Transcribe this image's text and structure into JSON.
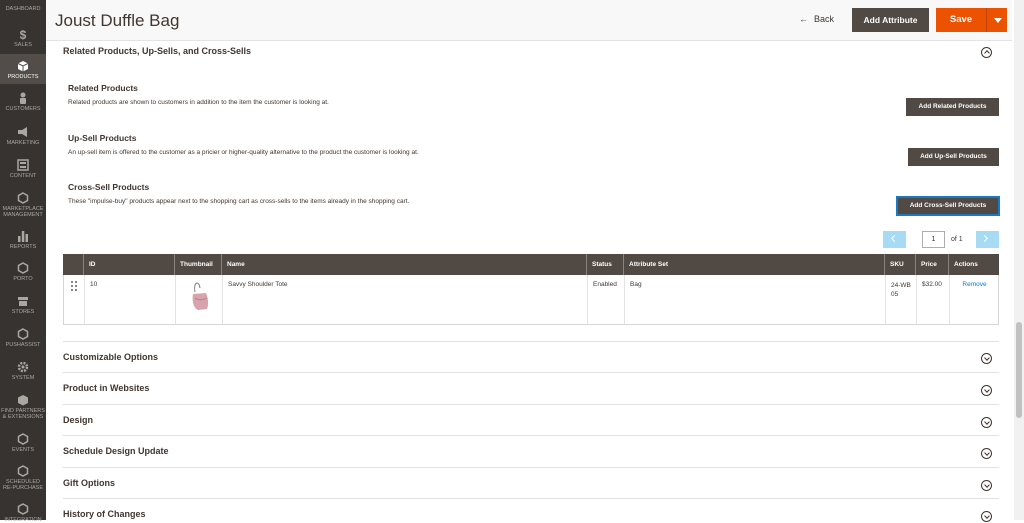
{
  "sidebar": {
    "items": [
      {
        "label": "Dashboard",
        "icon": "dashboard-icon"
      },
      {
        "label": "Sales",
        "icon": "dollar-icon"
      },
      {
        "label": "Products",
        "icon": "cube-icon"
      },
      {
        "label": "Customers",
        "icon": "person-icon"
      },
      {
        "label": "Marketing",
        "icon": "megaphone-icon"
      },
      {
        "label": "Content",
        "icon": "content-icon"
      },
      {
        "label": "Marketplace",
        "label2": "Management",
        "icon": "hexagon-icon"
      },
      {
        "label": "Reports",
        "icon": "bar-chart-icon"
      },
      {
        "label": "Porto",
        "icon": "hexagon-icon"
      },
      {
        "label": "Stores",
        "icon": "store-icon"
      },
      {
        "label": "Pushassist",
        "icon": "hexagon-icon"
      },
      {
        "label": "System",
        "icon": "gear-icon"
      },
      {
        "label": "Find Partners",
        "label2": "& Extensions",
        "icon": "partners-icon"
      },
      {
        "label": "Events",
        "icon": "hexagon-icon"
      },
      {
        "label": "Scheduled",
        "label2": "Re-Purchase",
        "icon": "hexagon-icon"
      },
      {
        "label": "Integration",
        "icon": "hexagon-icon"
      }
    ]
  },
  "header": {
    "title": "Joust Duffle Bag",
    "back_label": "Back",
    "add_attribute_label": "Add Attribute",
    "save_label": "Save"
  },
  "related_section": {
    "title": "Related Products, Up-Sells, and Cross-Sells",
    "related": {
      "title": "Related Products",
      "description": "Related products are shown to customers in addition to the item the customer is looking at.",
      "button": "Add Related Products"
    },
    "upsell": {
      "title": "Up-Sell Products",
      "description": "An up-sell item is offered to the customer as a pricier or higher-quality alternative to the product the customer is looking at.",
      "button": "Add Up-Sell Products"
    },
    "crosssell": {
      "title": "Cross-Sell Products",
      "description": "These \"impulse-buy\" products appear next to the shopping cart as cross-sells to the items already in the shopping cart.",
      "button": "Add Cross-Sell Products"
    }
  },
  "pager": {
    "page": "1",
    "of_label": "of 1"
  },
  "grid": {
    "columns": [
      "ID",
      "Thumbnail",
      "Name",
      "Status",
      "Attribute Set",
      "SKU",
      "Price",
      "Actions"
    ],
    "rows": [
      {
        "id": "10",
        "name": "Savvy Shoulder Tote",
        "status": "Enabled",
        "attribute_set": "Bag",
        "sku": "24-WB05",
        "price": "$32.00",
        "action": "Remove"
      }
    ]
  },
  "sections": [
    "Customizable Options",
    "Product in Websites",
    "Design",
    "Schedule Design Update",
    "Gift Options",
    "History of Changes"
  ],
  "colors": {
    "sidebar_bg": "#373330",
    "button_dark": "#514943",
    "save": "#eb5202",
    "link": "#007bdb",
    "pager": "#a6dbf3"
  }
}
